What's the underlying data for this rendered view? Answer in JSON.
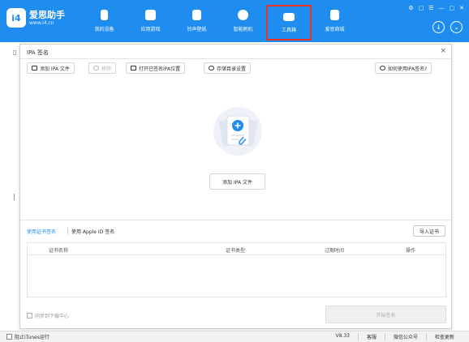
{
  "app": {
    "logo_badge": "i4",
    "name": "爱思助手",
    "url": "www.i4.cn",
    "brand_color": "#1f8cf0",
    "highlight_color": "#e5332a"
  },
  "nav": [
    {
      "label": "我的设备",
      "icon": "phone-icon"
    },
    {
      "label": "应用游戏",
      "icon": "cube-icon"
    },
    {
      "label": "铃声壁纸",
      "icon": "music-icon"
    },
    {
      "label": "智能刷机",
      "icon": "gear-icon"
    },
    {
      "label": "工具箱",
      "icon": "toolbox-icon",
      "active": true
    },
    {
      "label": "爱思商城",
      "icon": "bag-icon"
    }
  ],
  "window_controls": [
    "⚙",
    "▢",
    "☰",
    "—",
    "▢",
    "✕"
  ],
  "dialog": {
    "title": "IPA 签名",
    "close": "×",
    "toolbar": {
      "add_ipa": "添加 IPA 文件",
      "remove": "移除",
      "open_folder": "打开已签名IPA位置",
      "storage": "存储目录设置",
      "help": "如何使用IPA签名?"
    },
    "add_button": "添加 IPA 文件",
    "tabs": {
      "cert": "使用证书签名",
      "appleid": "使用 Apple ID 签名"
    },
    "import_cert": "导入证书",
    "table_headers": [
      "证书名称",
      "证书类型",
      "过期时间",
      "操作"
    ],
    "sync_label": "同步到下载中心",
    "start_button": "开始签名"
  },
  "status": {
    "block_itunes": "阻止iTunes运行",
    "version": "V8.33",
    "feedback": "客服",
    "wechat": "微信公众号",
    "update": "检查更新"
  }
}
